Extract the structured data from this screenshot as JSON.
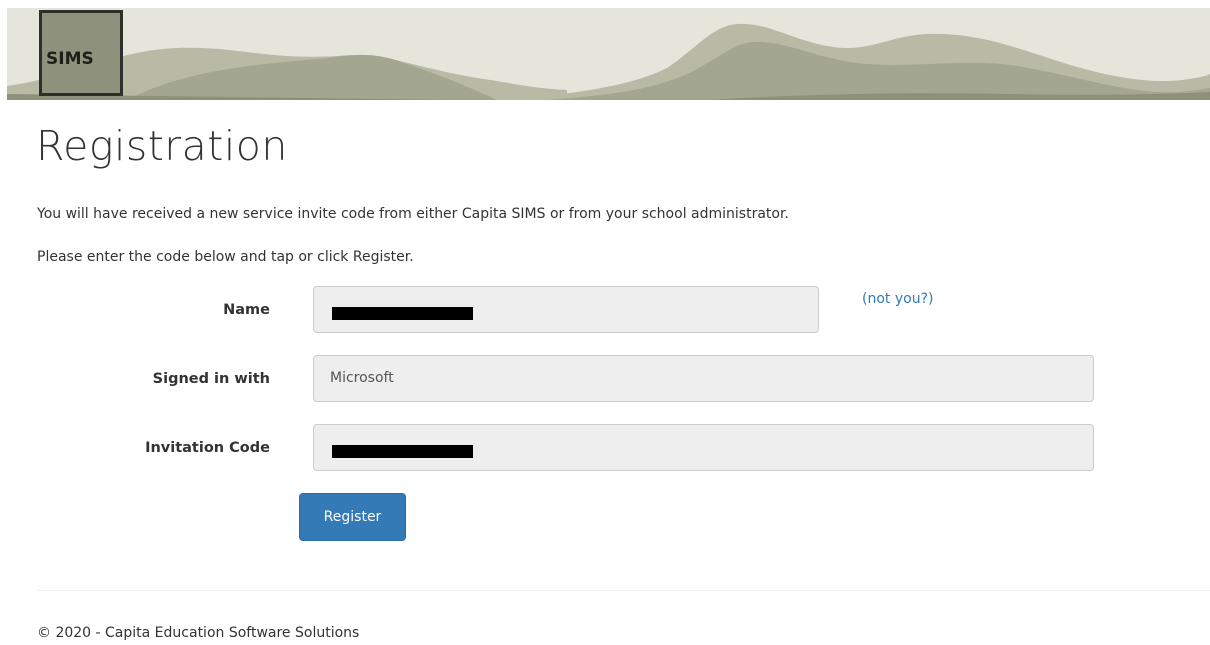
{
  "header": {
    "logo_text": "SIMS",
    "banner_sky_color": "#e6e5dc",
    "banner_mountain_colors": [
      "#b8baa5",
      "#a3a690",
      "#8d917a"
    ]
  },
  "page": {
    "title": "Registration",
    "intro_line_1": "You will have received a new service invite code from either Capita SIMS or from your school administrator.",
    "intro_line_2": "Please enter the code below and tap or click Register."
  },
  "form": {
    "name": {
      "label": "Name",
      "value": "",
      "redacted": true,
      "not_you_link": "(not you?)"
    },
    "signed_in_with": {
      "label": "Signed in with",
      "value": "Microsoft"
    },
    "invitation_code": {
      "label": "Invitation Code",
      "value": "",
      "redacted": true
    },
    "register_button": "Register"
  },
  "footer": {
    "copyright": "© 2020 - Capita Education Software Solutions"
  },
  "colors": {
    "accent": "#337ab7",
    "field_background": "#eeeeee",
    "field_border": "#cccccc"
  }
}
